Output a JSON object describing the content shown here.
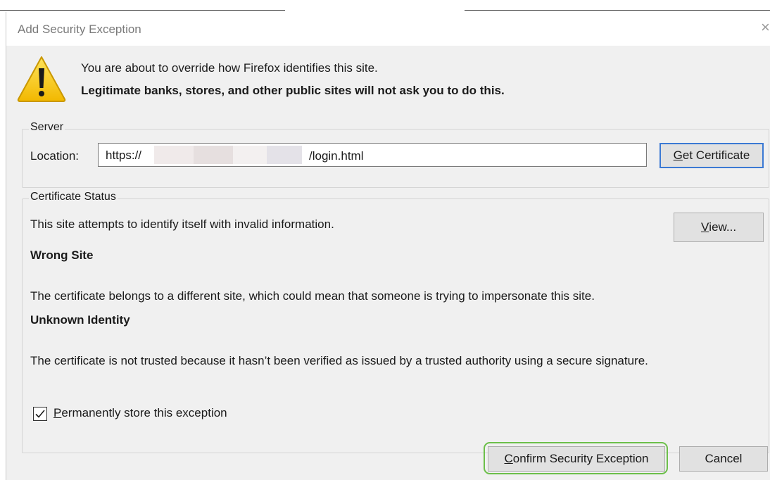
{
  "dialog": {
    "title": "Add Security Exception",
    "close_glyph": "×",
    "intro_line": "You are about to override how Firefox identifies this site.",
    "intro_warning": "Legitimate banks, stores, and other public sites will not ask you to do this."
  },
  "server": {
    "group_label": "Server",
    "location_label": "Location:",
    "location_prefix": "https://",
    "location_suffix": "/login.html",
    "get_certificate_label": "et Certificate",
    "get_certificate_mnemonic": "G"
  },
  "status": {
    "group_label": "Certificate Status",
    "summary": "This site attempts to identify itself with invalid information.",
    "view_label_mnemonic": "V",
    "view_label_rest": "iew...",
    "wrong_site_title": "Wrong Site",
    "wrong_site_desc": "The certificate belongs to a different site, which could mean that someone is trying to impersonate this site.",
    "unknown_identity_title": "Unknown Identity",
    "unknown_identity_desc": "The certificate is not trusted because it hasn’t been verified as issued by a trusted authority using a secure signature."
  },
  "options": {
    "permanent_mnemonic": "P",
    "permanent_rest": "ermanently store this exception",
    "permanent_checked": true
  },
  "actions": {
    "confirm_mnemonic": "C",
    "confirm_rest": "onfirm Security Exception",
    "cancel_label": "Cancel"
  },
  "colors": {
    "focus_border": "#3b79d4",
    "highlight_ring": "#6cbf4a",
    "warning_yellow": "#f5c400"
  },
  "icons": {
    "warning": "warning-triangle-icon",
    "checkbox": "checkmark-icon",
    "close": "close-icon"
  }
}
